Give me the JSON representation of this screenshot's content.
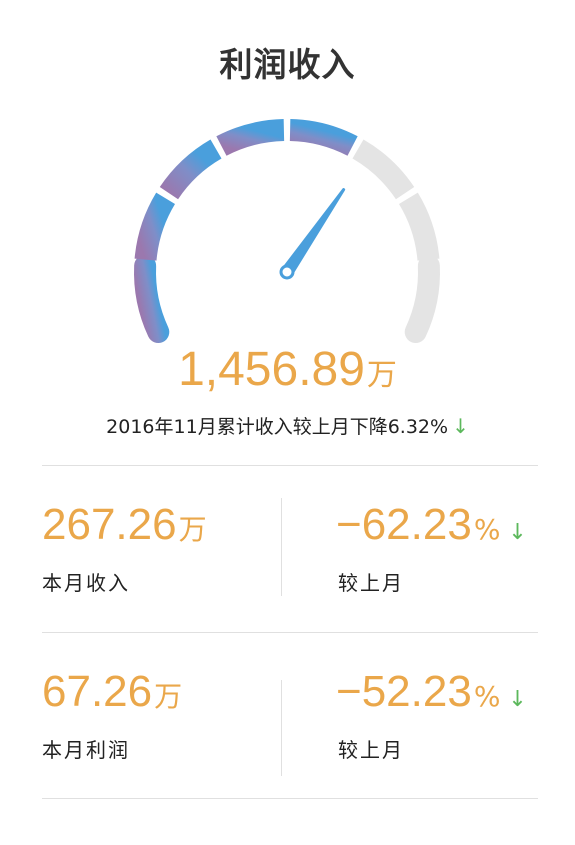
{
  "title": "利润收入",
  "gauge": {
    "level": 0.65,
    "colors": {
      "purple": "#9b7bb0",
      "blue": "#4a9fdc",
      "gray": "#e4e4e4",
      "needle": "#4a9fdc"
    }
  },
  "total": {
    "value": "1,456.89",
    "unit": "万"
  },
  "summary": {
    "text": "2016年11月累计收入较上月下降6.32%",
    "arrow": "↓"
  },
  "stats": [
    {
      "value": "267.26",
      "unit": "万",
      "label": "本月收入",
      "change": "−62.23",
      "change_unit": "%",
      "arrow": "↓",
      "change_label": "较上月"
    },
    {
      "value": "67.26",
      "unit": "万",
      "label": "本月利润",
      "change": "−52.23",
      "change_unit": "%",
      "arrow": "↓",
      "change_label": "较上月"
    }
  ],
  "colors": {
    "accent": "#eaa74a",
    "down": "#5cb85c",
    "divider": "#e0e0e0"
  }
}
